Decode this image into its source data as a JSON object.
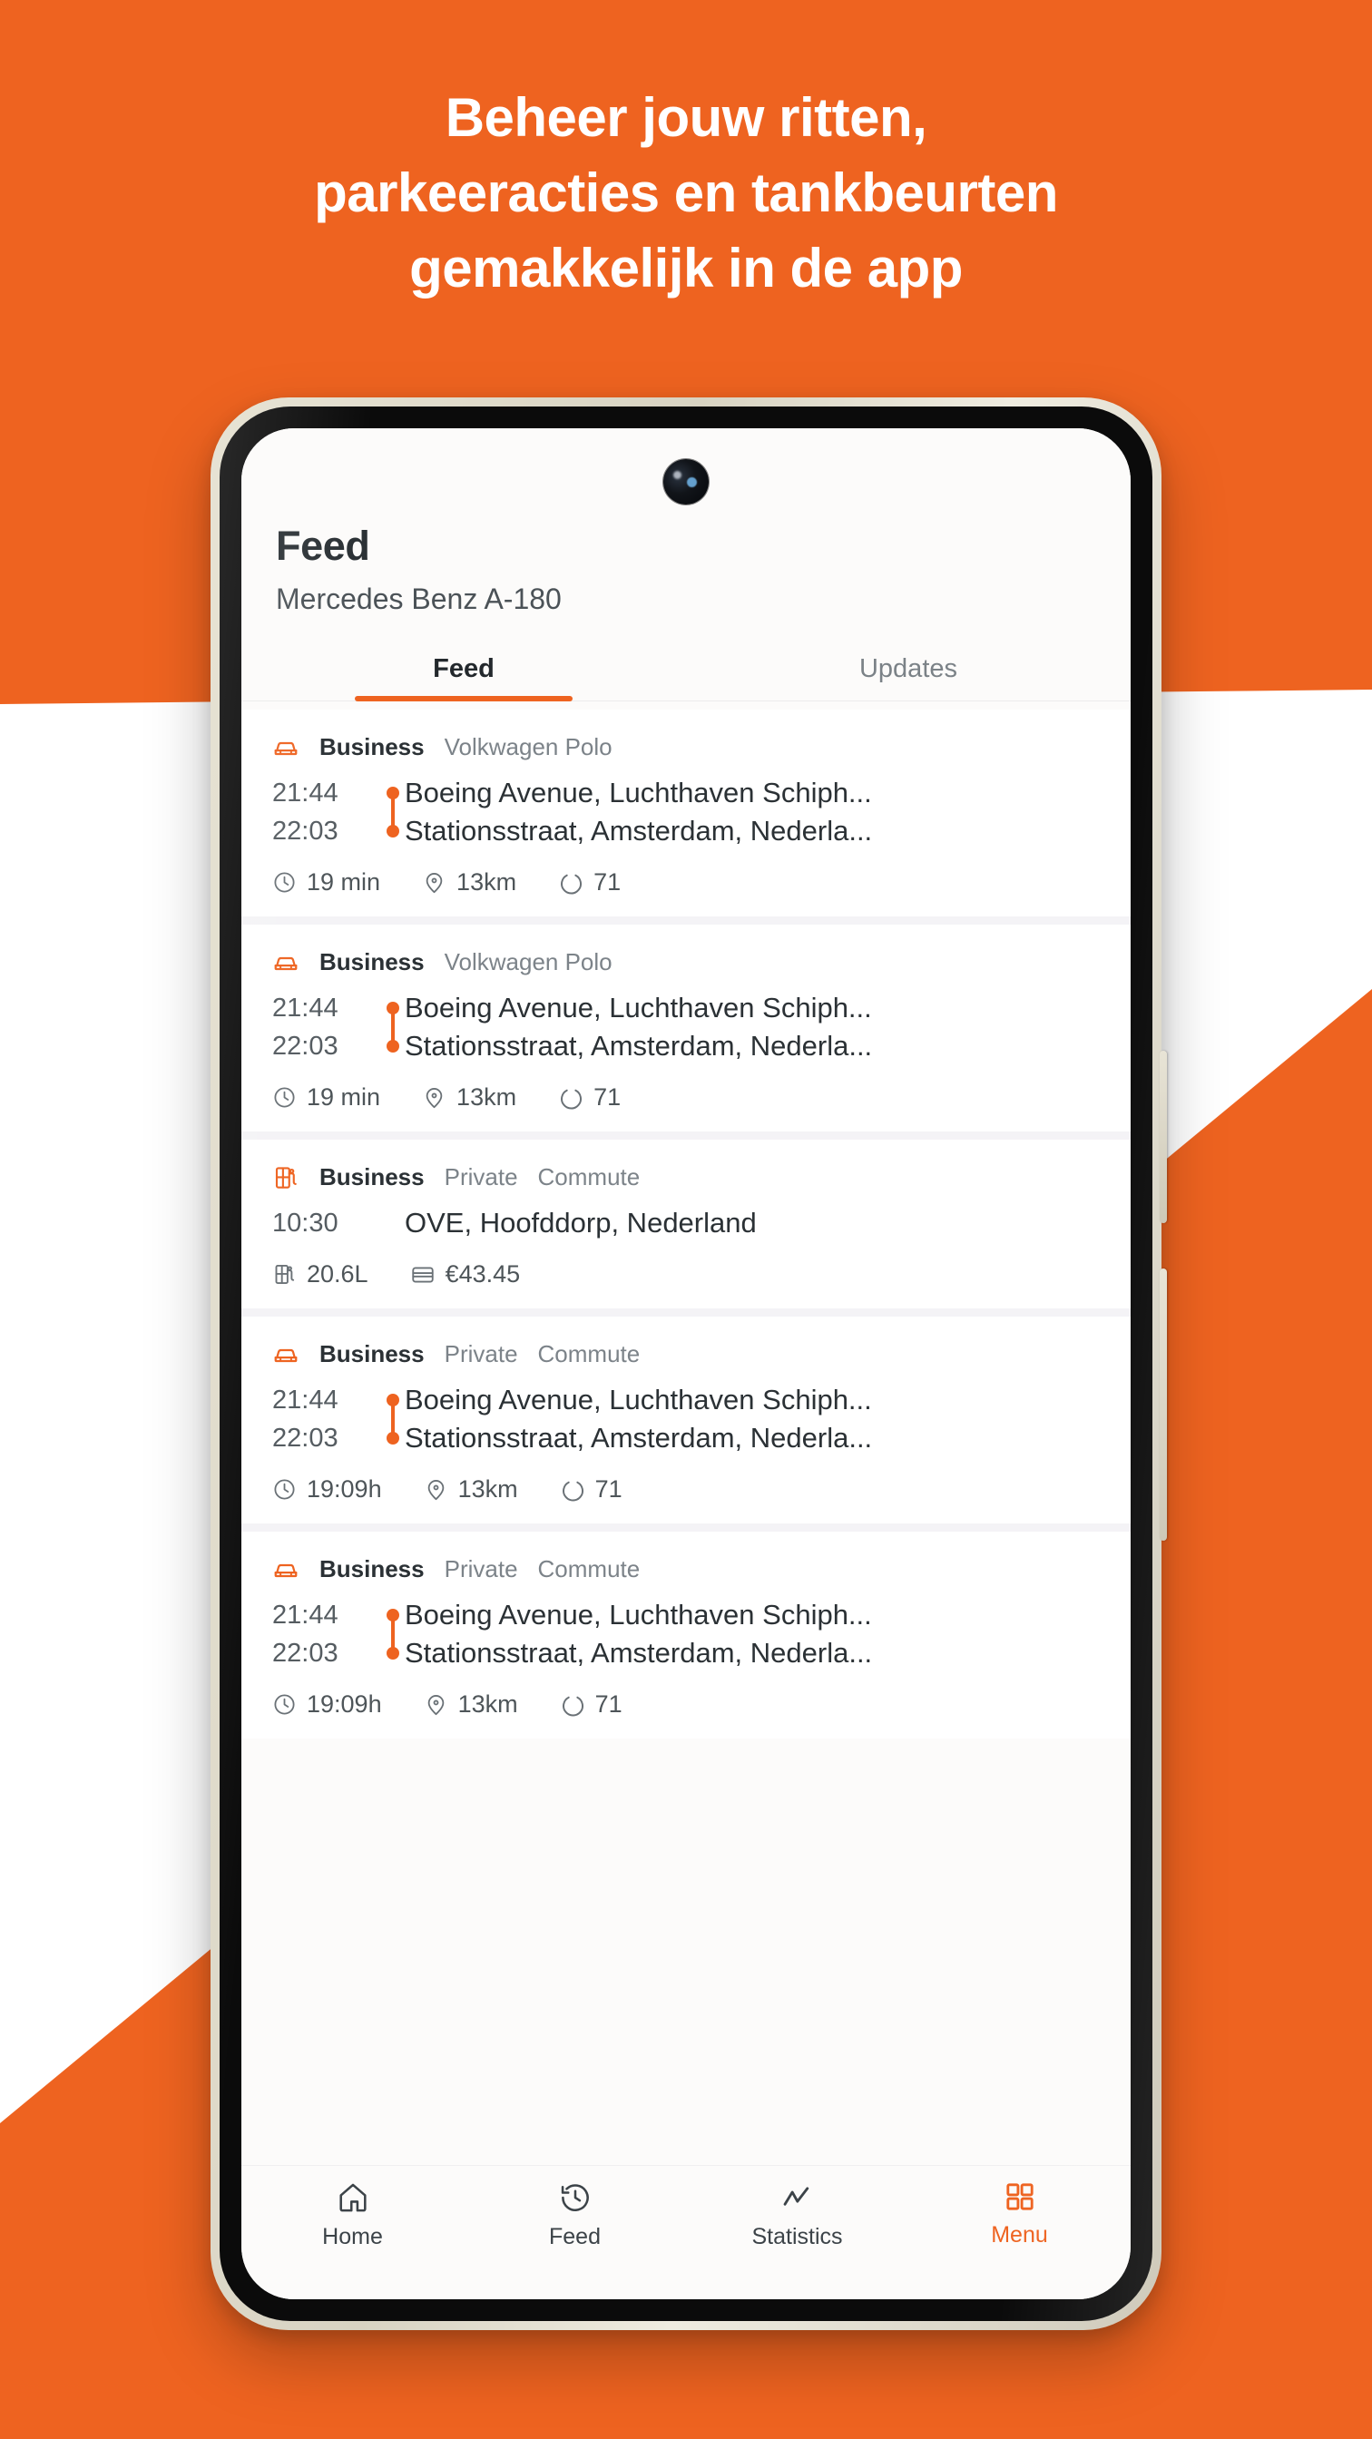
{
  "promo": {
    "headline_lines": [
      "Beheer jouw ritten,",
      "parkeeracties en tankbeurten",
      "gemakkelijk in de app"
    ],
    "brand_color": "#EE6320",
    "background_color": "#FFFFFF"
  },
  "app": {
    "header": {
      "title": "Feed",
      "subtitle": "Mercedes Benz A-180"
    },
    "tabs": [
      {
        "label": "Feed",
        "active": true
      },
      {
        "label": "Updates",
        "active": false
      }
    ],
    "feed": [
      {
        "type": "trip",
        "icon": "car-icon",
        "tags": [
          "Business",
          "Volkwagen Polo"
        ],
        "start_time": "21:44",
        "end_time": "22:03",
        "start_place": "Boeing Avenue, Luchthaven Schiph...",
        "end_place": "Stationsstraat, Amsterdam, Nederla...",
        "metrics": [
          {
            "icon": "clock-icon",
            "value": "19 min"
          },
          {
            "icon": "pin-icon",
            "value": "13km"
          },
          {
            "icon": "gauge-icon",
            "value": "71"
          }
        ]
      },
      {
        "type": "trip",
        "icon": "car-icon",
        "tags": [
          "Business",
          "Volkwagen Polo"
        ],
        "start_time": "21:44",
        "end_time": "22:03",
        "start_place": "Boeing Avenue, Luchthaven Schiph...",
        "end_place": "Stationsstraat, Amsterdam, Nederla...",
        "metrics": [
          {
            "icon": "clock-icon",
            "value": "19 min"
          },
          {
            "icon": "pin-icon",
            "value": "13km"
          },
          {
            "icon": "gauge-icon",
            "value": "71"
          }
        ]
      },
      {
        "type": "fuel",
        "icon": "fuel-pump-icon",
        "tags": [
          "Business",
          "Private",
          "Commute"
        ],
        "time": "10:30",
        "place": "OVE, Hoofddorp, Nederland",
        "metrics": [
          {
            "icon": "fuel-pump-icon",
            "value": "20.6L"
          },
          {
            "icon": "credit-card-icon",
            "value": "€43.45"
          }
        ]
      },
      {
        "type": "trip",
        "icon": "car-icon",
        "tags": [
          "Business",
          "Private",
          "Commute"
        ],
        "start_time": "21:44",
        "end_time": "22:03",
        "start_place": "Boeing Avenue, Luchthaven Schiph...",
        "end_place": "Stationsstraat, Amsterdam, Nederla...",
        "metrics": [
          {
            "icon": "clock-icon",
            "value": "19:09h"
          },
          {
            "icon": "pin-icon",
            "value": "13km"
          },
          {
            "icon": "gauge-icon",
            "value": "71"
          }
        ]
      },
      {
        "type": "trip",
        "icon": "car-icon",
        "tags": [
          "Business",
          "Private",
          "Commute"
        ],
        "start_time": "21:44",
        "end_time": "22:03",
        "start_place": "Boeing Avenue, Luchthaven Schiph...",
        "end_place": "Stationsstraat, Amsterdam, Nederla...",
        "metrics": [
          {
            "icon": "clock-icon",
            "value": "19:09h"
          },
          {
            "icon": "pin-icon",
            "value": "13km"
          },
          {
            "icon": "gauge-icon",
            "value": "71"
          }
        ]
      }
    ],
    "bottom_nav": [
      {
        "label": "Home",
        "icon": "home-icon",
        "active": false
      },
      {
        "label": "Feed",
        "icon": "history-clock-icon",
        "active": false
      },
      {
        "label": "Statistics",
        "icon": "trend-line-icon",
        "active": false
      },
      {
        "label": "Menu",
        "icon": "grid-squares-icon",
        "active": true
      }
    ]
  }
}
